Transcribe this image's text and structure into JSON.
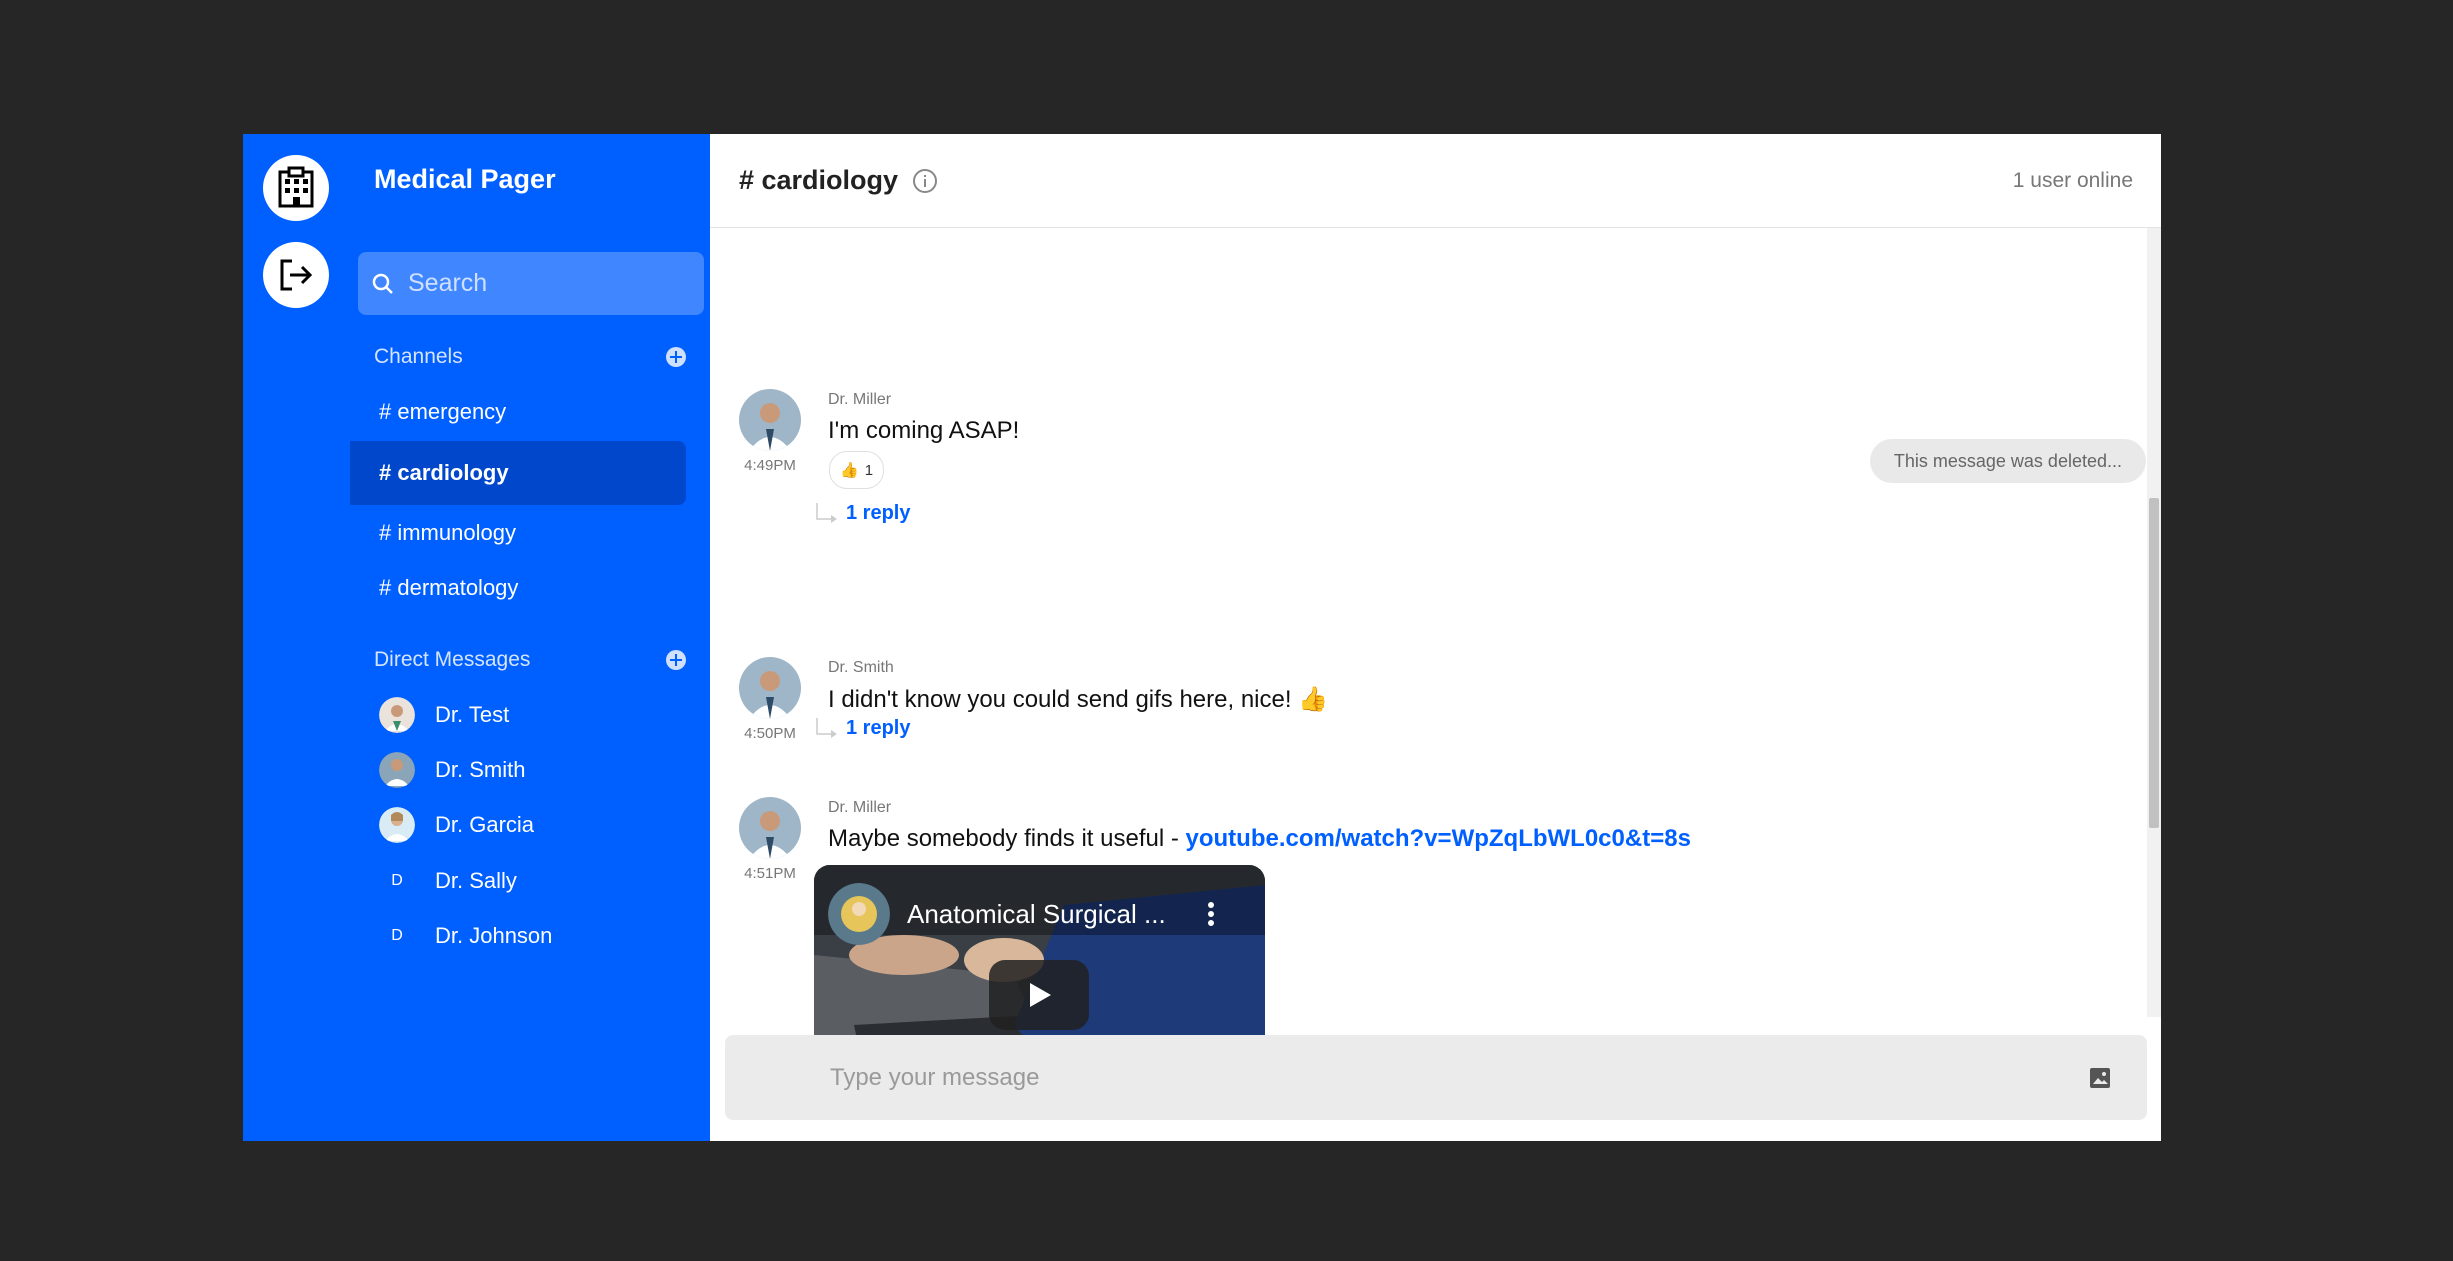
{
  "app": {
    "name": "Medical Pager"
  },
  "rail": {
    "hospital_icon": "hospital-icon",
    "logout_icon": "logout-icon"
  },
  "sidebar": {
    "search_placeholder": "Search",
    "channels_heading": "Channels",
    "channels": [
      {
        "label": "# emergency",
        "active": false
      },
      {
        "label": "# cardiology",
        "active": true
      },
      {
        "label": "# immunology",
        "active": false
      },
      {
        "label": "# dermatology",
        "active": false
      }
    ],
    "dm_heading": "Direct Messages",
    "direct_messages": [
      {
        "name": "Dr. Test",
        "initial": ""
      },
      {
        "name": "Dr. Smith",
        "initial": ""
      },
      {
        "name": "Dr. Garcia",
        "initial": ""
      },
      {
        "name": "Dr. Sally",
        "initial": "D"
      },
      {
        "name": "Dr. Johnson",
        "initial": "D"
      }
    ]
  },
  "header": {
    "channel": "# cardiology",
    "online": "1 user online"
  },
  "messages": [
    {
      "author": "Dr. Miller",
      "time": "4:49PM",
      "text": "I'm coming ASAP!",
      "reaction_emoji": "👍",
      "reaction_count": "1",
      "reply": "1 reply"
    },
    {
      "deleted": "This message was deleted..."
    },
    {
      "author": "Dr. Smith",
      "time": "4:50PM",
      "text": "I didn't know you could send gifs here, nice! 👍",
      "reply": "1 reply"
    },
    {
      "author": "Dr. Miller",
      "time": "4:51PM",
      "text": "Maybe somebody finds it useful - ",
      "link": "youtube.com/watch?v=WpZqLbWL0c0&t=8s",
      "video_title": "Anatomical Surgical ..."
    }
  ],
  "composer": {
    "placeholder": "Type your message"
  },
  "colors": {
    "brand": "#005fff",
    "active_channel": "#0047cc",
    "link": "#005fff"
  }
}
